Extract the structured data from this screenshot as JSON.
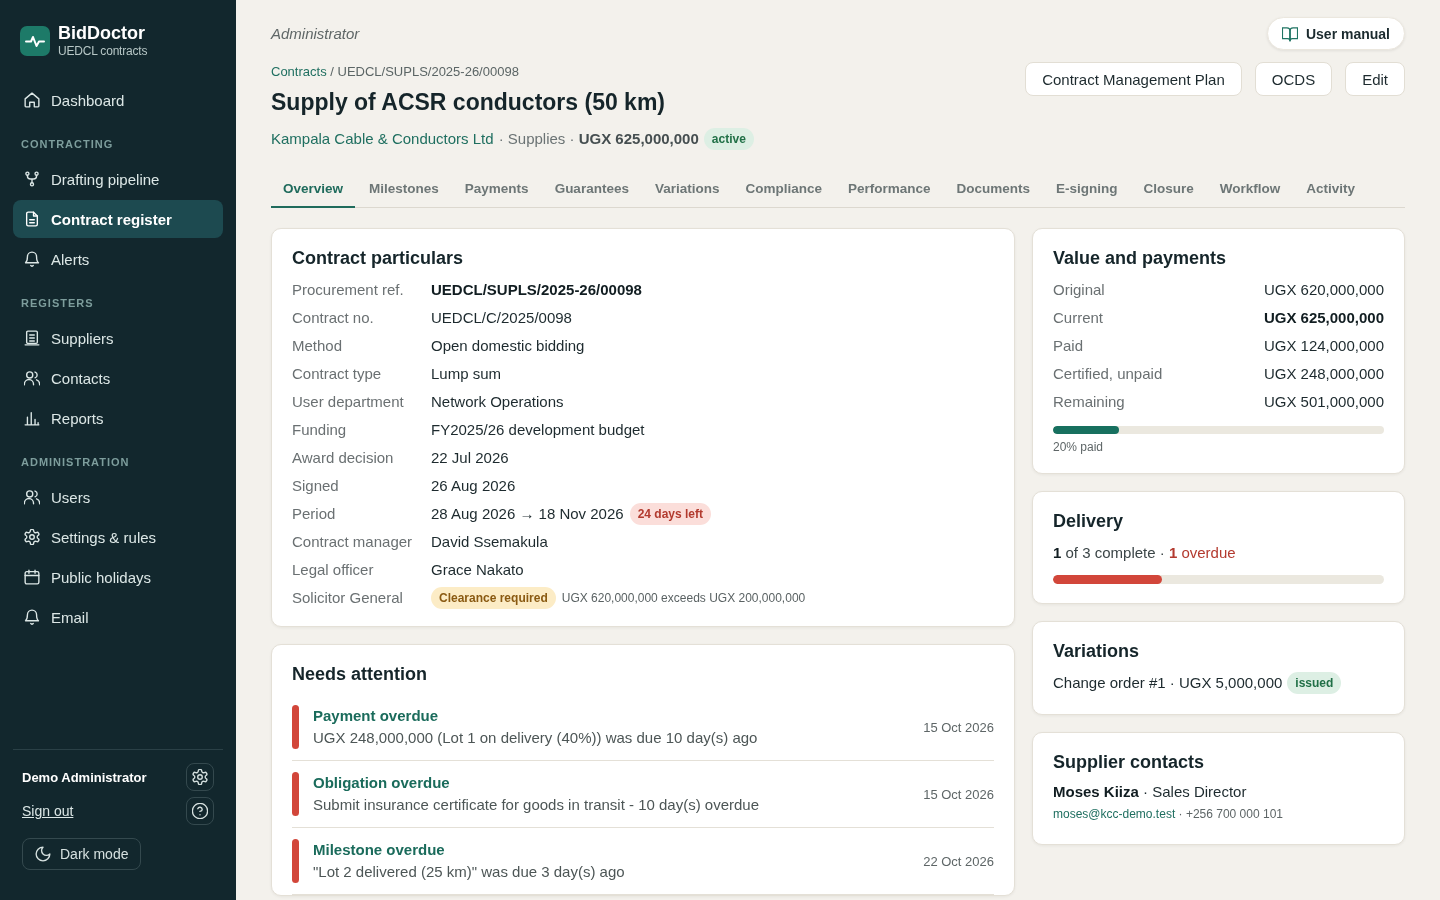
{
  "sidebar": {
    "brand": {
      "name": "BidDoctor",
      "subtitle": "UEDCL contracts"
    },
    "sections": [
      {
        "items": [
          {
            "label": "Dashboard",
            "selected": false
          }
        ]
      },
      {
        "heading": "CONTRACTING",
        "items": [
          {
            "label": "Drafting pipeline",
            "selected": false
          },
          {
            "label": "Contract register",
            "selected": true
          },
          {
            "label": "Alerts",
            "selected": false
          }
        ]
      },
      {
        "heading": "REGISTERS",
        "items": [
          {
            "label": "Suppliers",
            "selected": false
          },
          {
            "label": "Contacts",
            "selected": false
          },
          {
            "label": "Reports",
            "selected": false
          }
        ]
      },
      {
        "heading": "ADMINISTRATION",
        "items": [
          {
            "label": "Users",
            "selected": false
          },
          {
            "label": "Settings & rules",
            "selected": false
          },
          {
            "label": "Public holidays",
            "selected": false
          },
          {
            "label": "Email",
            "selected": false
          }
        ]
      }
    ],
    "user": {
      "name": "Demo Administrator",
      "sign_out": "Sign out"
    },
    "dark_mode_button": "Dark mode"
  },
  "header": {
    "role": "Administrator",
    "user_manual_button": "User manual",
    "breadcrumb": {
      "link": "Contracts",
      "current": "/ UEDCL/SUPLS/2025-26/00098"
    },
    "title": "Supply of ACSR conductors (50 km)",
    "subtitle": {
      "supplier": "Kampala Cable & Conductors Ltd",
      "details": "· Supplies · **UGX 625,000,000**",
      "badge": {
        "label": "active",
        "kind": "success"
      }
    },
    "actions": [
      "Contract Management Plan",
      "OCDS",
      "Edit"
    ]
  },
  "tabs": [
    {
      "label": "Overview",
      "selected": true
    },
    {
      "label": "Milestones",
      "selected": false
    },
    {
      "label": "Payments",
      "selected": false
    },
    {
      "label": "Guarantees",
      "selected": false
    },
    {
      "label": "Variations",
      "selected": false
    },
    {
      "label": "Compliance",
      "selected": false
    },
    {
      "label": "Performance",
      "selected": false
    },
    {
      "label": "Documents",
      "selected": false
    },
    {
      "label": "E-signing",
      "selected": false
    },
    {
      "label": "Closure",
      "selected": false
    },
    {
      "label": "Workflow",
      "selected": false
    },
    {
      "label": "Activity",
      "selected": false
    }
  ],
  "contract_particulars": {
    "title": "Contract particulars",
    "rows": [
      {
        "label": "Procurement ref.",
        "value": "UEDCL/SUPLS/2025-26/00098",
        "emphasis": true
      },
      {
        "label": "Contract no.",
        "value": "UEDCL/C/2025/0098",
        "emphasis": false
      },
      {
        "label": "Method",
        "value": "Open domestic bidding",
        "emphasis": false
      },
      {
        "label": "Contract type",
        "value": "Lump sum",
        "emphasis": false
      },
      {
        "label": "User department",
        "value": "Network Operations",
        "emphasis": false
      },
      {
        "label": "Funding",
        "value": "FY2025/26 development budget",
        "emphasis": false
      },
      {
        "label": "Award decision",
        "value": "22 Jul 2026",
        "emphasis": false
      },
      {
        "label": "Signed",
        "value": "26 Aug 2026",
        "emphasis": false
      },
      {
        "label": "Period",
        "value": "28 Aug 2026 → 18 Nov 2026",
        "emphasis": false,
        "badge": {
          "label": "24 days left",
          "kind": "danger"
        }
      },
      {
        "label": "Contract manager",
        "value": "David Ssemakula",
        "emphasis": false
      },
      {
        "label": "Legal officer",
        "value": "Grace Nakato",
        "emphasis": false
      },
      {
        "label": "Solicitor General",
        "badge": {
          "label": "Clearance required",
          "kind": "warning"
        },
        "note": "UGX 620,000,000 exceeds UGX 200,000,000"
      }
    ]
  },
  "needs_attention": {
    "title": "Needs attention",
    "items": [
      {
        "title": "Payment overdue",
        "description": "UGX 248,000,000 (Lot 1 on delivery (40%)) was due 10 day(s) ago",
        "date": "15 Oct 2026"
      },
      {
        "title": "Obligation overdue",
        "description": "Submit insurance certificate for goods in transit - 10 day(s) overdue",
        "date": "15 Oct 2026"
      },
      {
        "title": "Milestone overdue",
        "description": "\"Lot 2 delivered (25 km)\" was due 3 day(s) ago",
        "date": "22 Oct 2026"
      }
    ]
  },
  "value_and_payments": {
    "title": "Value and payments",
    "rows": [
      {
        "label": "Original",
        "value": "UGX 620,000,000",
        "emphasis": false
      },
      {
        "label": "Current",
        "value": "UGX 625,000,000",
        "emphasis": true
      },
      {
        "label": "Paid",
        "value": "UGX 124,000,000",
        "emphasis": false
      },
      {
        "label": "Certified, unpaid",
        "value": "UGX 248,000,000",
        "emphasis": false
      },
      {
        "label": "Remaining",
        "value": "UGX 501,000,000",
        "emphasis": false
      }
    ],
    "progress": {
      "level": 0.2,
      "caption": "20% paid"
    }
  },
  "delivery": {
    "title": "Delivery",
    "summary": "**1** of 3 complete ·",
    "overdue": "**1** overdue",
    "progress": {
      "level": 0.33
    }
  },
  "variations": {
    "title": "Variations",
    "text": "Change order #1 · UGX 5,000,000",
    "badge": {
      "label": "issued",
      "kind": "success"
    }
  },
  "supplier_contacts": {
    "title": "Supplier contacts",
    "person": "**Moses Kiiza** · Sales Director",
    "email": "moses@kcc-demo.test",
    "phone": "· +256 700 000 101"
  }
}
